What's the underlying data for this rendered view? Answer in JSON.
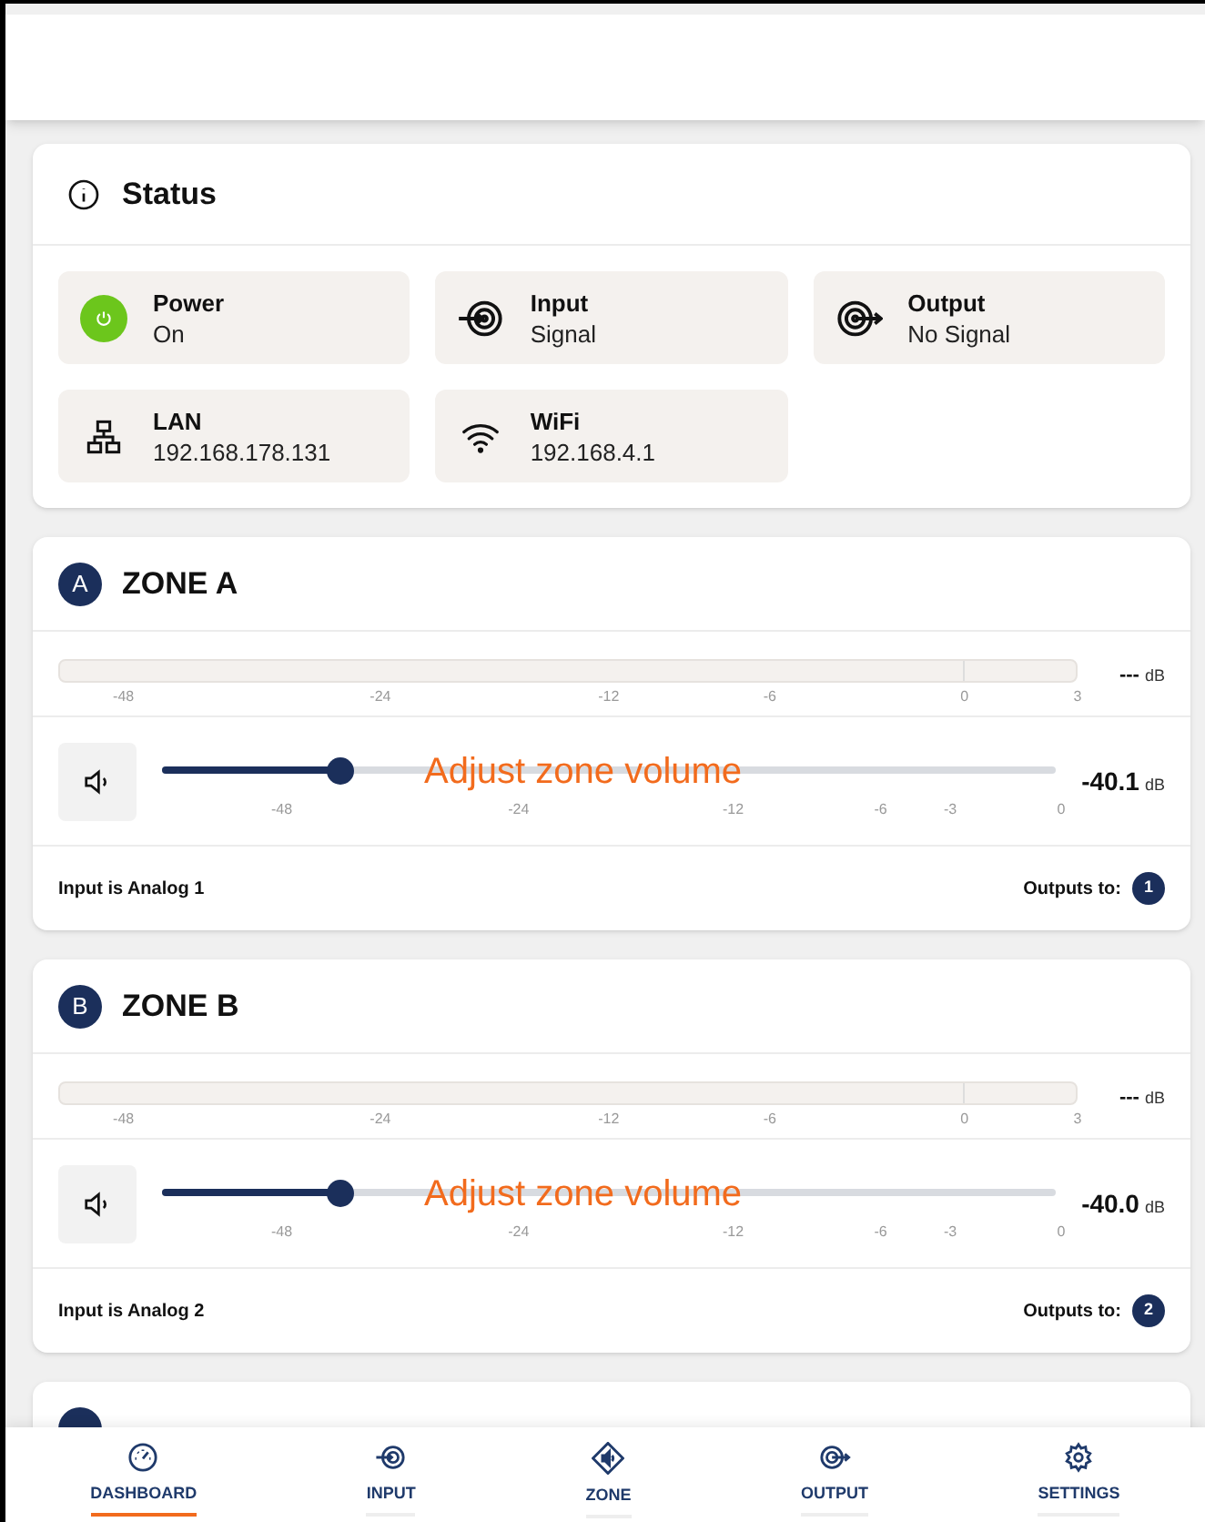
{
  "status": {
    "title": "Status",
    "tiles": [
      {
        "kind": "power",
        "label": "Power",
        "value": "On",
        "on": true
      },
      {
        "kind": "input",
        "label": "Input",
        "value": "Signal"
      },
      {
        "kind": "output",
        "label": "Output",
        "value": "No Signal"
      },
      {
        "kind": "lan",
        "label": "LAN",
        "value": "192.168.178.131"
      },
      {
        "kind": "wifi",
        "label": "WiFi",
        "value": "192.168.4.1"
      }
    ]
  },
  "zones": [
    {
      "kind": "full",
      "badge": "A",
      "title": "ZONE A",
      "meter": {
        "level": 0,
        "reading": "---",
        "unit": "dB",
        "ticks": [
          "-48",
          "-24",
          "-12",
          "-6",
          "0",
          "3"
        ]
      },
      "volume": {
        "level": 0.2,
        "reading": "-40.1",
        "unit": "dB",
        "ticks": [
          "-48",
          "-24",
          "-12",
          "-6",
          "-3",
          "0"
        ],
        "tooltip": "Adjust zone volume"
      },
      "input_text": "Input is Analog 1",
      "outputs_label": "Outputs to:",
      "outputs": [
        "1"
      ]
    },
    {
      "kind": "full",
      "badge": "B",
      "title": "ZONE B",
      "meter": {
        "level": 0,
        "reading": "---",
        "unit": "dB",
        "ticks": [
          "-48",
          "-24",
          "-12",
          "-6",
          "0",
          "3"
        ]
      },
      "volume": {
        "level": 0.2,
        "reading": "-40.0",
        "unit": "dB",
        "ticks": [
          "-48",
          "-24",
          "-12",
          "-6",
          "-3",
          "0"
        ],
        "tooltip": "Adjust zone volume"
      },
      "input_text": "Input is Analog 2",
      "outputs_label": "Outputs to:",
      "outputs": [
        "2"
      ]
    },
    {
      "kind": "covered"
    }
  ],
  "nav": [
    {
      "kind": "dashboard",
      "label": "DASHBOARD",
      "selected": true
    },
    {
      "kind": "input",
      "label": "INPUT",
      "selected": false
    },
    {
      "kind": "zone",
      "label": "ZONE",
      "selected": false
    },
    {
      "kind": "output",
      "label": "OUTPUT",
      "selected": false
    },
    {
      "kind": "settings",
      "label": "SETTINGS",
      "selected": false
    }
  ]
}
